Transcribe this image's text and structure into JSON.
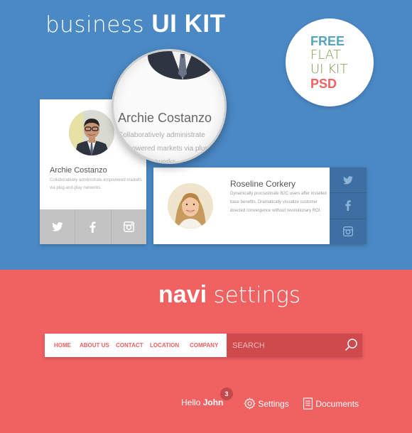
{
  "header": {
    "title_light": "business",
    "title_bold": "UI KIT"
  },
  "badge": {
    "free": "FREE",
    "flat": "FLAT",
    "uikit": "UI KIT",
    "psd": "PSD"
  },
  "card1": {
    "name": "Archie Costanzo",
    "description": "Collaboratively administrate empowered markets via plug-and-play networks.",
    "social": [
      "twitter-icon",
      "facebook-icon",
      "instagram-icon"
    ]
  },
  "magnifier": {
    "name": "Archie Costanzo",
    "description": "Collaboratively administrate empowered markets via plug-and-play networks."
  },
  "card2": {
    "name": "Roseline Corkery",
    "description": "Dynamically procrastinate B2C users after installed base benefits. Dramatically visualize customer directed convergence without revolutionary ROI."
  },
  "navi": {
    "title_bold": "navi",
    "title_light": "settings",
    "items": [
      "HOME",
      "ABOUT US",
      "CONTACT",
      "LOCATION",
      "COMPANY"
    ],
    "search_placeholder": "SEARCH"
  },
  "status": {
    "hello": "Hello",
    "user": "John",
    "notification_count": "3",
    "settings": "Settings",
    "documents": "Documents"
  },
  "colors": {
    "top_bg": "#4b89c5",
    "bottom_bg": "#f06162",
    "accent_red": "#ef5e5f",
    "search_bg": "#cf4a4d",
    "social_gray": "#c3c3c3",
    "social_blue": "#3d6fa2"
  }
}
